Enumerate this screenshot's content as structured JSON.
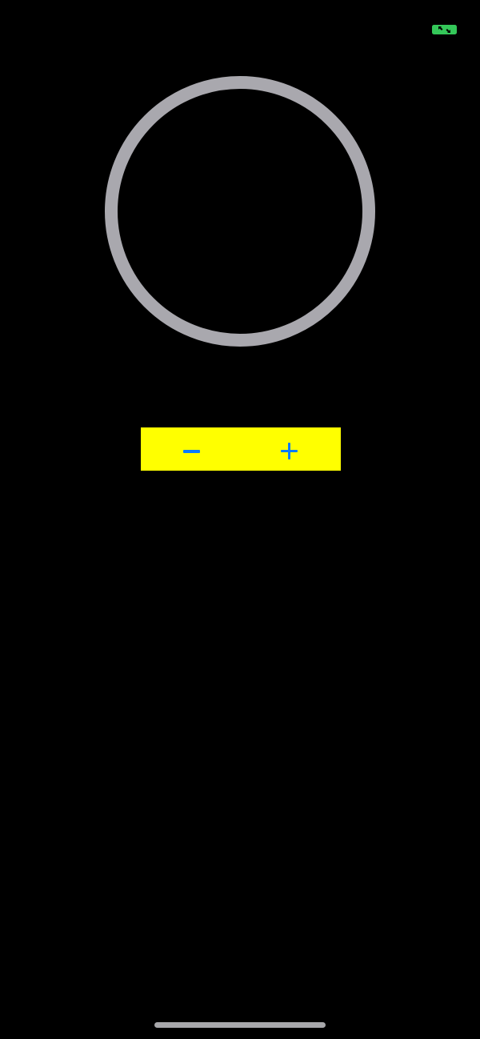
{
  "status_bar": {
    "indicator_icon": "charging-arrows-icon",
    "indicator_color": "#34c759"
  },
  "progress_ring": {
    "progress": 0,
    "track_color": "#a9a8ae",
    "fill_color": "#0a7bff"
  },
  "stepper": {
    "background_color": "#ffff00",
    "tint_color": "#0a7bff",
    "decrement_icon": "minus-icon",
    "increment_icon": "plus-icon"
  },
  "home_indicator": {
    "color": "#a8a8ab"
  }
}
